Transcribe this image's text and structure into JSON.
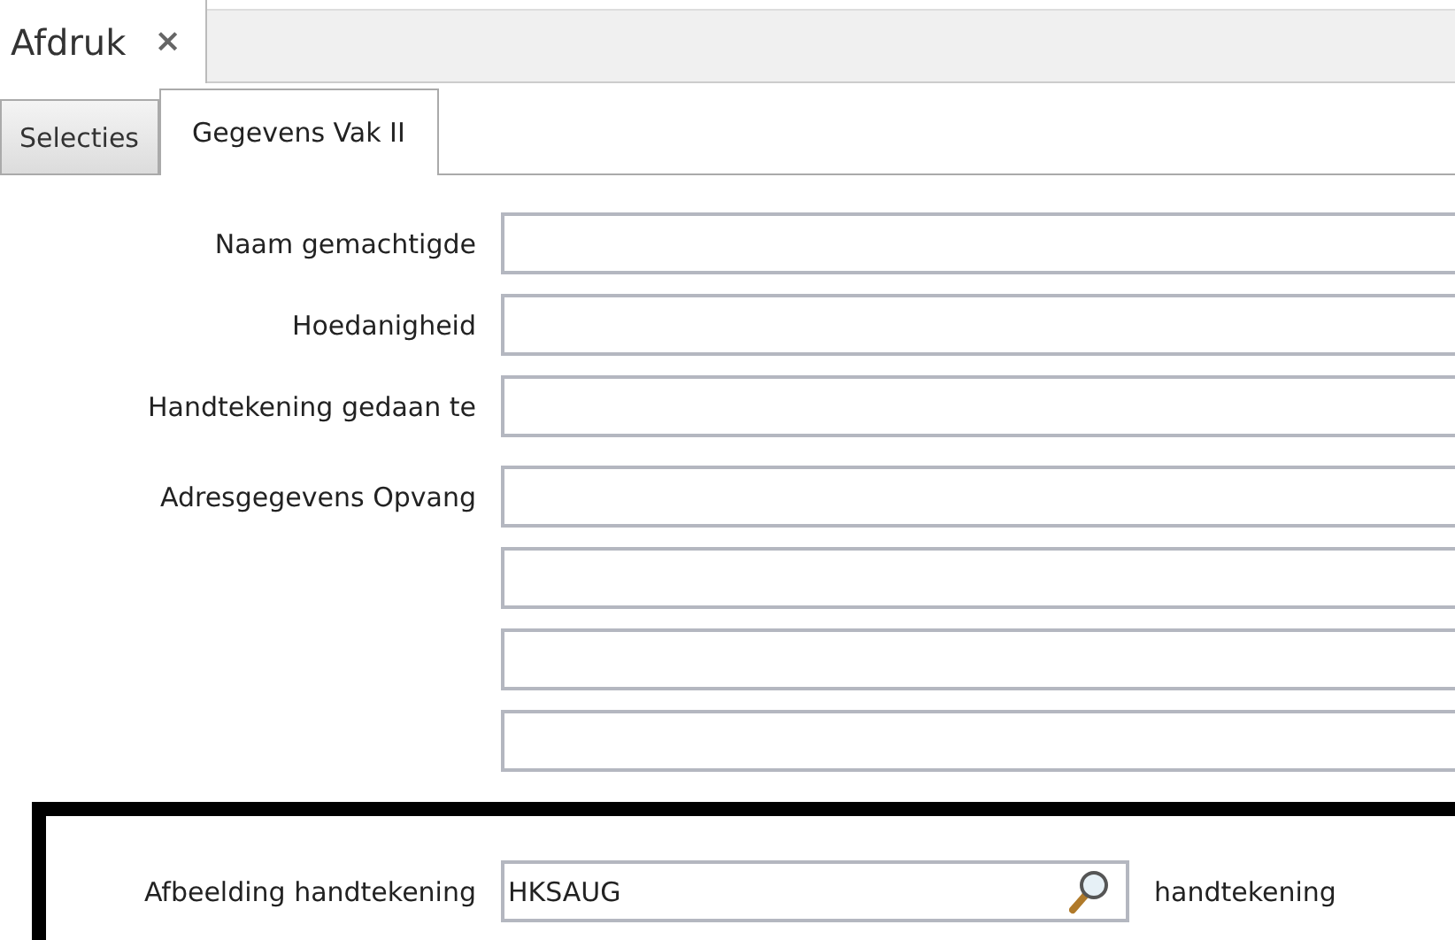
{
  "document_tab": {
    "label": "Afdruk",
    "close": "×",
    "selected": true
  },
  "tabs": [
    {
      "label": "Selecties",
      "selected": false
    },
    {
      "label": "Gegevens Vak II",
      "selected": true
    }
  ],
  "sections": [
    {
      "highlighted": false,
      "fields": [
        {
          "kind": "text",
          "label": "Naam gemachtigde"
        },
        {
          "kind": "text",
          "label": "Hoedanigheid"
        },
        {
          "kind": "text",
          "label": "Handtekening gedaan te"
        }
      ]
    },
    {
      "highlighted": false,
      "fields": [
        {
          "kind": "text",
          "label": "Adresgegevens Opvang"
        },
        {
          "kind": "text"
        },
        {
          "kind": "text"
        },
        {
          "kind": "text"
        }
      ]
    },
    {
      "highlighted": true,
      "fields": [
        {
          "kind": "lookup",
          "label": "Afbeelding handtekening",
          "value": "HKSAUG",
          "description": "handtekening"
        }
      ]
    }
  ]
}
